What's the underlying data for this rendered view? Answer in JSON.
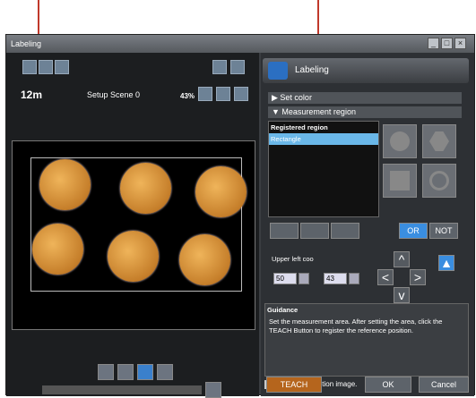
{
  "window": {
    "title": "Labeling"
  },
  "left": {
    "zoom_level": "12m",
    "scene": "Setup Scene 0",
    "zoom_pct": "43%"
  },
  "right": {
    "title": "Labeling",
    "sections": {
      "set_color": "▶ Set color",
      "measurement": "▼ Measurement region"
    },
    "list": {
      "items": [
        "Registered region",
        "Rectangle"
      ]
    },
    "buttons": {
      "or": "OR",
      "not": "NOT",
      "teach": "TEACH",
      "ok": "OK",
      "cancel": "Cancel"
    },
    "upper_left": "Upper left coo",
    "inputs": {
      "x": "50",
      "y": "43"
    },
    "guidance": {
      "title": "Guidance",
      "text": "Set the measurement area. After setting the area, click the TEACH Button to register the reference position."
    },
    "checkbox": "Display extraction image."
  }
}
